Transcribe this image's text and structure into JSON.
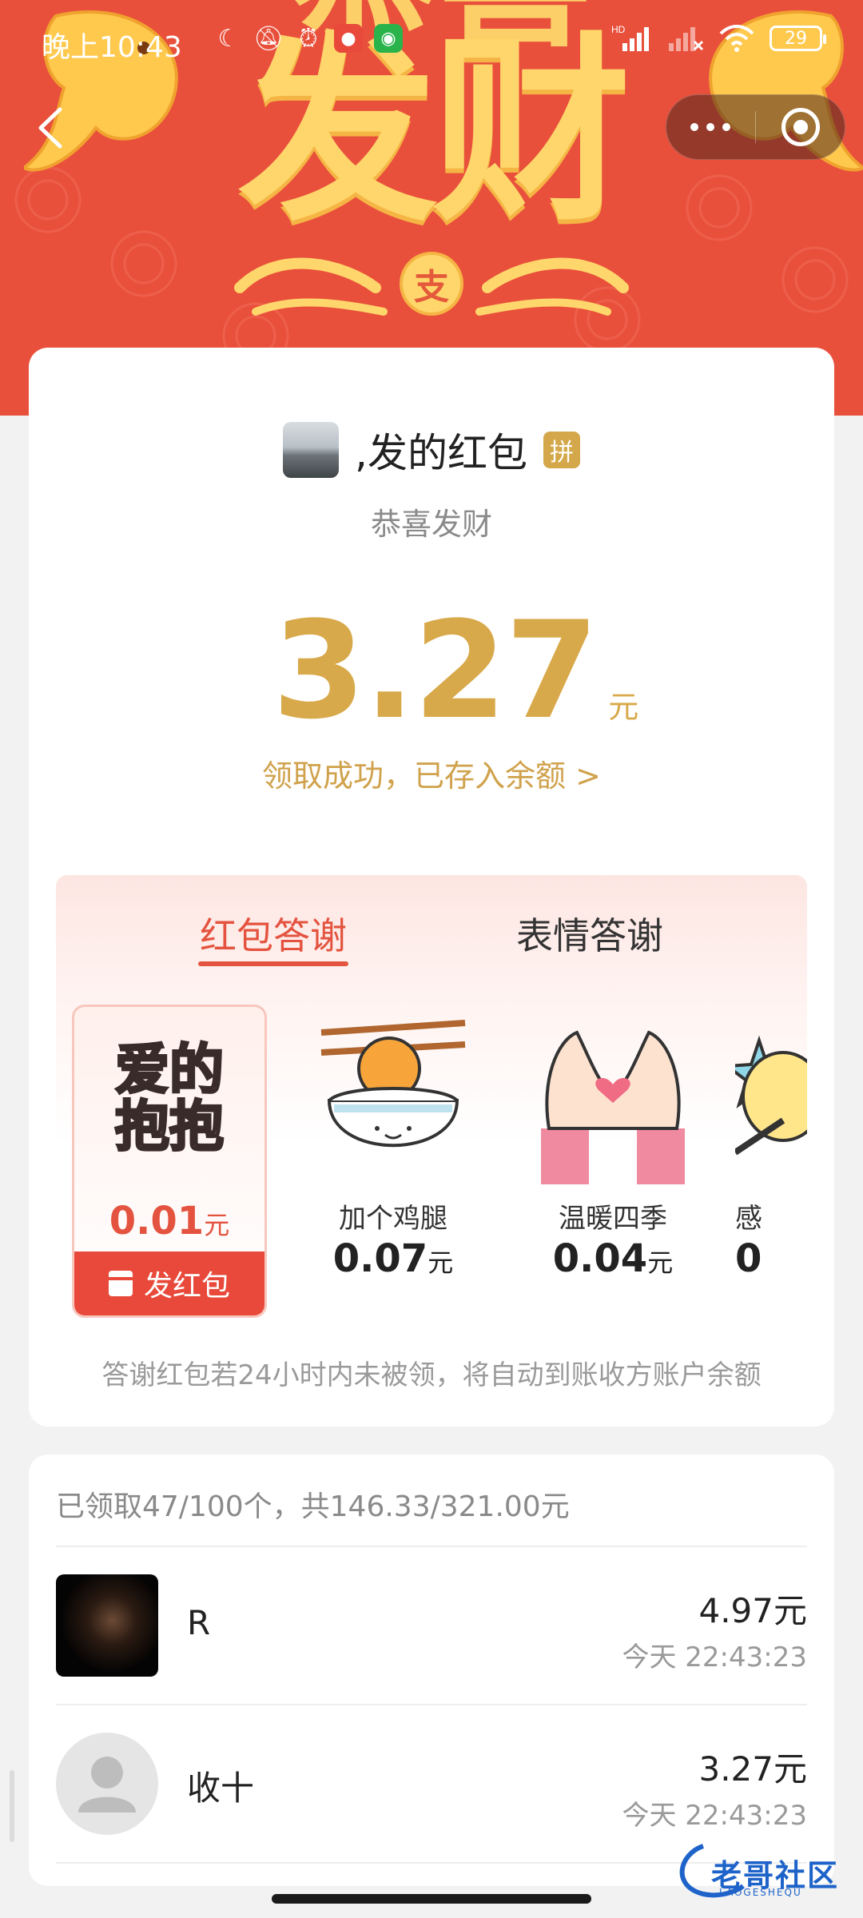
{
  "status_bar": {
    "time": "晚上10:43",
    "battery": "29",
    "network_label": "HD"
  },
  "banner": {
    "title": "发财",
    "title_top": "恭喜",
    "coin_glyph": "支",
    "colors": {
      "background": "#e9503c",
      "gold": "#ffd66b"
    }
  },
  "nav": {
    "back_icon": "chevron-left-icon",
    "more_icon": "more-dots-icon",
    "close_icon": "target-close-icon"
  },
  "packet": {
    "sender": ",发的红包",
    "badge": "拼",
    "greeting": "恭喜发财",
    "amount": "3.27",
    "amount_unit": "元",
    "status_link": "领取成功，已存入余额 >"
  },
  "thanks": {
    "tabs": [
      {
        "label": "红包答谢",
        "active": true
      },
      {
        "label": "表情答谢",
        "active": false
      }
    ],
    "gifts": [
      {
        "sticker_line1": "爱的",
        "sticker_line2": "抱抱",
        "price": "0.01",
        "unit": "元",
        "selected": true
      },
      {
        "name": "加个鸡腿",
        "price": "0.07",
        "unit": "元"
      },
      {
        "name": "温暖四季",
        "price": "0.04",
        "unit": "元"
      },
      {
        "name": "感",
        "price": "0",
        "unit": ""
      }
    ],
    "send_button": "发红包",
    "footnote": "答谢红包若24小时内未被领，将自动到账收方账户余额"
  },
  "receipts": {
    "summary": "已领取47/100个，共146.33/321.00元",
    "rows": [
      {
        "name": "R",
        "amount": "4.97元",
        "time": "今天 22:43:23"
      },
      {
        "name": "收十",
        "amount": "3.27元",
        "time": "今天 22:43:23"
      }
    ]
  },
  "watermark": {
    "text": "老哥社区",
    "sub": "LAOGESHEQU"
  },
  "colors": {
    "accent_red": "#e8493a",
    "gold_text": "#d8a94a"
  }
}
